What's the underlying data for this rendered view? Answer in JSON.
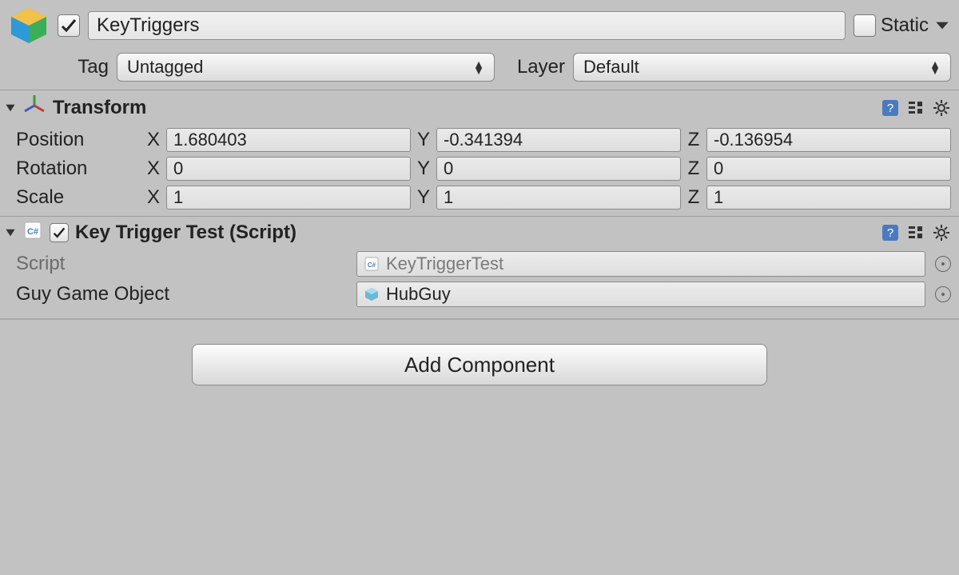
{
  "header": {
    "name": "KeyTriggers",
    "active": true,
    "static_label": "Static",
    "static_checked": false,
    "tag_label": "Tag",
    "tag_value": "Untagged",
    "layer_label": "Layer",
    "layer_value": "Default"
  },
  "transform": {
    "title": "Transform",
    "position_label": "Position",
    "rotation_label": "Rotation",
    "scale_label": "Scale",
    "axis": {
      "x": "X",
      "y": "Y",
      "z": "Z"
    },
    "position": {
      "x": "1.680403",
      "y": "-0.341394",
      "z": "-0.136954"
    },
    "rotation": {
      "x": "0",
      "y": "0",
      "z": "0"
    },
    "scale": {
      "x": "1",
      "y": "1",
      "z": "1"
    }
  },
  "script_component": {
    "title": "Key Trigger Test (Script)",
    "enabled": true,
    "script_label": "Script",
    "script_value": "KeyTriggerTest",
    "prop_label": "Guy Game Object",
    "prop_value": "HubGuy"
  },
  "add_component_label": "Add Component"
}
